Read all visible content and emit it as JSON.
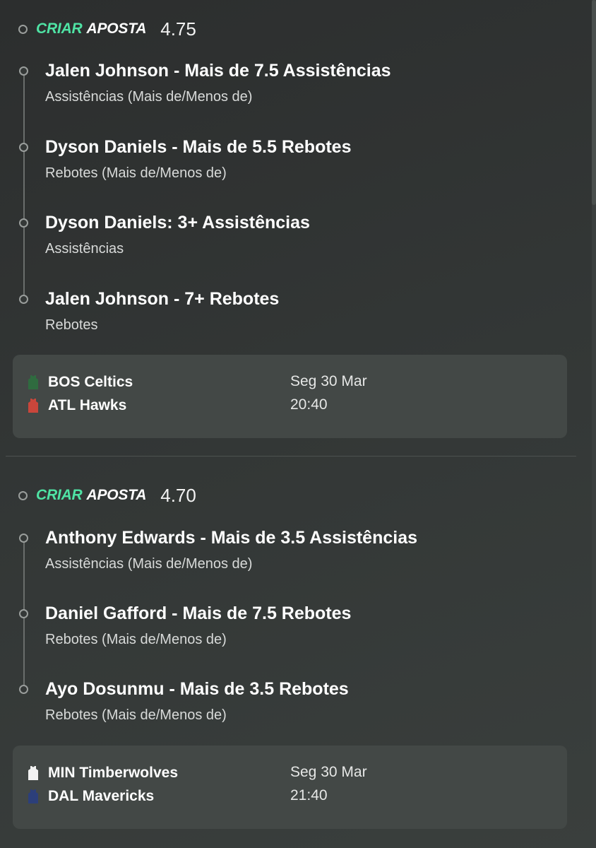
{
  "bets": [
    {
      "brand_criar": "CRIAR",
      "brand_aposta": "APOSTA",
      "odds": "4.75",
      "legs": [
        {
          "title": "Jalen Johnson - Mais de 7.5 Assistências",
          "market": "Assistências (Mais de/Menos de)"
        },
        {
          "title": "Dyson Daniels - Mais de 5.5 Rebotes",
          "market": "Rebotes (Mais de/Menos de)"
        },
        {
          "title": "Dyson Daniels: 3+ Assistências",
          "market": "Assistências"
        },
        {
          "title": "Jalen Johnson - 7+ Rebotes",
          "market": "Rebotes"
        }
      ],
      "match": {
        "home_team": "BOS Celtics",
        "away_team": "ATL Hawks",
        "date": "Seg 30 Mar",
        "time": "20:40",
        "home_jersey_color": "#2f6b3f",
        "away_jersey_color": "#c9463b",
        "home_jersey_icon": "green-jersey-icon",
        "away_jersey_icon": "red-jersey-icon"
      }
    },
    {
      "brand_criar": "CRIAR",
      "brand_aposta": "APOSTA",
      "odds": "4.70",
      "legs": [
        {
          "title": "Anthony Edwards - Mais de 3.5 Assistências",
          "market": "Assistências (Mais de/Menos de)"
        },
        {
          "title": "Daniel Gafford - Mais de 7.5 Rebotes",
          "market": "Rebotes (Mais de/Menos de)"
        },
        {
          "title": "Ayo Dosunmu - Mais de 3.5 Rebotes",
          "market": "Rebotes (Mais de/Menos de)"
        }
      ],
      "match": {
        "home_team": "MIN Timberwolves",
        "away_team": "DAL Mavericks",
        "date": "Seg 30 Mar",
        "time": "21:40",
        "home_jersey_color": "#f2f2f2",
        "away_jersey_color": "#2c3f7a",
        "home_jersey_icon": "white-jersey-icon",
        "away_jersey_icon": "navy-jersey-icon"
      }
    }
  ],
  "colors": {
    "accent": "#4fe3a4",
    "background": "#333736",
    "match_box": "#434846"
  }
}
